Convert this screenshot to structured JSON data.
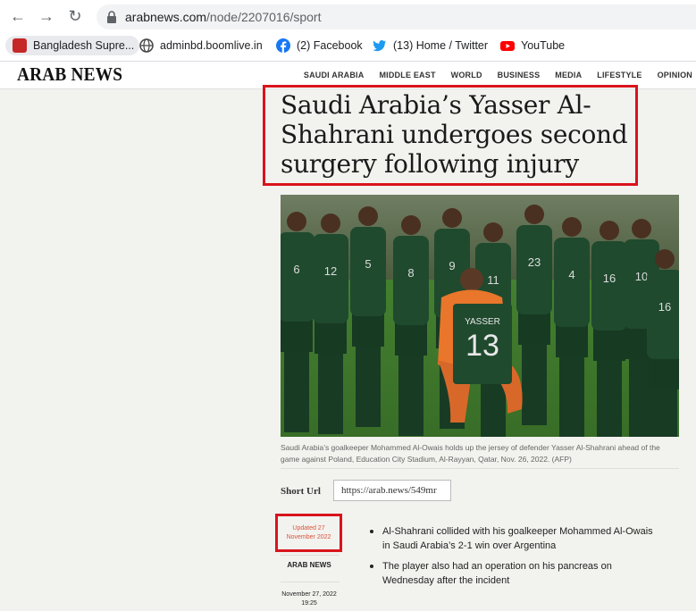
{
  "browser": {
    "url_domain": "arabnews.com",
    "url_path": "/node/2207016/sport",
    "bookmarks": [
      {
        "label": "Bangladesh Supre...",
        "icon": "bangladesh-supreme-court-favicon"
      },
      {
        "label": "adminbd.boomlive.in",
        "icon": "globe-icon"
      },
      {
        "label": "(2) Facebook",
        "icon": "facebook-icon"
      },
      {
        "label": "(13) Home / Twitter",
        "icon": "twitter-icon"
      },
      {
        "label": "YouTube",
        "icon": "youtube-icon"
      }
    ]
  },
  "site": {
    "logo": "ARAB NEWS",
    "nav": [
      "SAUDI ARABIA",
      "MIDDLE EAST",
      "WORLD",
      "BUSINESS",
      "MEDIA",
      "LIFESTYLE",
      "OPINION"
    ]
  },
  "article": {
    "headline": "Saudi Arabia’s Yasser Al-Shahrani undergoes second surgery following injury",
    "photo": {
      "jersey_name": "YASSER",
      "jersey_number": "13",
      "player_numbers": [
        "6",
        "12",
        "5",
        "8",
        "9",
        "11",
        "23",
        "4",
        "16",
        "10",
        "16"
      ]
    },
    "caption": "Saudi Arabia’s goalkeeper Mohammed Al-Owais holds up the jersey of defender Yasser Al-Shahrani ahead of the game against Poland, Education City Stadium, Al-Rayyan, Qatar, Nov. 26, 2022. (AFP)",
    "short_url_label": "Short Url",
    "short_url_value": "https://arab.news/549mr",
    "updated": "Updated 27 November 2022",
    "source": "ARAB NEWS",
    "published_date": "November 27, 2022",
    "published_time": "19:25",
    "bullets": [
      "Al-Shahrani collided with his goalkeeper Mohammed Al-Owais in Saudi Arabia’s 2-1 win over Argentina",
      "The player also had an operation on his pancreas on Wednesday after the incident"
    ]
  },
  "colors": {
    "highlight_red": "#d9141b",
    "jersey_green": "#1f4a2e",
    "pitch_green": "#3f7a2e",
    "keeper_orange": "#e9762b"
  }
}
